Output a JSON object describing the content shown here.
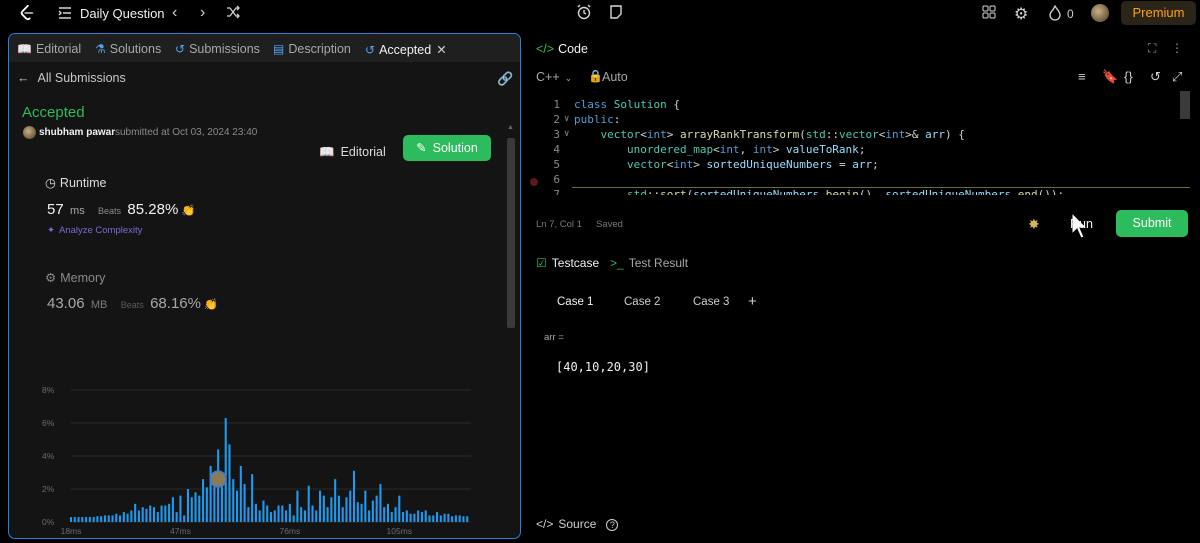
{
  "topbar": {
    "daily_question": "Daily Question",
    "flame_count": "0",
    "premium": "Premium"
  },
  "left": {
    "tabs": [
      {
        "label": "Editorial"
      },
      {
        "label": "Solutions"
      },
      {
        "label": "Submissions"
      },
      {
        "label": "Description"
      },
      {
        "label": "Accepted"
      }
    ],
    "back_label": "All Submissions",
    "status": "Accepted",
    "user": "shubham pawar",
    "submitted": "submitted at Oct 03, 2024 23:40",
    "editorial_btn": "Editorial",
    "solution_btn": "Solution",
    "runtime": {
      "title": "Runtime",
      "value": "57",
      "unit": "ms",
      "beats_label": "Beats",
      "beats": "85.28%",
      "analyze": "Analyze Complexity"
    },
    "memory": {
      "title": "Memory",
      "value": "43.06",
      "unit": "MB",
      "beats_label": "Beats",
      "beats": "68.16%"
    }
  },
  "chart_data": {
    "type": "bar",
    "yticks": [
      "8%",
      "6%",
      "4%",
      "2%",
      "0%"
    ],
    "ylim": [
      0,
      8
    ],
    "xticks": [
      {
        "label": "18ms",
        "x": 18
      },
      {
        "label": "47ms",
        "x": 47
      },
      {
        "label": "76ms",
        "x": 76
      },
      {
        "label": "105ms",
        "x": 105
      }
    ],
    "xlim": [
      18,
      124
    ],
    "x": [
      18,
      19,
      20,
      21,
      22,
      23,
      24,
      25,
      26,
      27,
      28,
      29,
      30,
      31,
      32,
      33,
      34,
      35,
      36,
      37,
      38,
      39,
      40,
      41,
      42,
      43,
      44,
      45,
      46,
      47,
      48,
      49,
      50,
      51,
      52,
      53,
      54,
      55,
      56,
      57,
      58,
      59,
      60,
      61,
      62,
      63,
      64,
      65,
      66,
      67,
      68,
      69,
      70,
      71,
      72,
      73,
      74,
      75,
      76,
      77,
      78,
      79,
      80,
      81,
      82,
      83,
      84,
      85,
      86,
      87,
      88,
      89,
      90,
      91,
      92,
      93,
      94,
      95,
      96,
      97,
      98,
      99,
      100,
      101,
      102,
      103,
      104,
      105,
      106,
      107,
      108,
      109,
      110,
      111,
      112,
      113,
      114,
      115,
      116,
      117,
      118,
      119,
      120,
      121,
      122,
      123
    ],
    "values": [
      0.3,
      0.3,
      0.3,
      0.3,
      0.3,
      0.3,
      0.3,
      0.35,
      0.35,
      0.4,
      0.4,
      0.4,
      0.5,
      0.4,
      0.6,
      0.5,
      0.7,
      1.1,
      0.7,
      0.9,
      0.8,
      1.0,
      0.9,
      0.6,
      1.0,
      1.0,
      1.1,
      1.5,
      0.6,
      1.6,
      0.4,
      2.0,
      1.5,
      1.8,
      1.6,
      2.6,
      2.1,
      3.4,
      2.5,
      4.4,
      2.3,
      6.3,
      4.7,
      2.6,
      1.9,
      3.4,
      2.3,
      0.9,
      2.9,
      1.1,
      0.7,
      1.3,
      1.0,
      0.6,
      0.7,
      1.0,
      1.0,
      0.7,
      1.1,
      0.4,
      1.9,
      0.9,
      0.7,
      2.2,
      1.0,
      0.7,
      1.9,
      1.6,
      0.9,
      1.5,
      2.6,
      1.6,
      0.9,
      1.5,
      1.9,
      3.1,
      1.2,
      1.1,
      1.9,
      0.7,
      1.3,
      1.6,
      2.3,
      0.9,
      1.1,
      0.6,
      0.9,
      1.6,
      0.6,
      0.7,
      0.5,
      0.5,
      0.7,
      0.6,
      0.7,
      0.4,
      0.4,
      0.6,
      0.4,
      0.5,
      0.5,
      0.35,
      0.4,
      0.4,
      0.35,
      0.35
    ]
  },
  "right": {
    "code_title": "Code",
    "language": "C++",
    "mode": "Auto",
    "code_lines": [
      {
        "n": "1"
      },
      {
        "n": "2"
      },
      {
        "n": "3"
      },
      {
        "n": "4"
      },
      {
        "n": "5"
      },
      {
        "n": "6"
      },
      {
        "n": "7"
      }
    ],
    "status_pos": "Ln 7, Col 1",
    "status_saved": "Saved",
    "run": "Run",
    "submit": "Submit",
    "testcase_tab": "Testcase",
    "testresult_tab": "Test Result",
    "cases": [
      "Case 1",
      "Case 2",
      "Case 3"
    ],
    "add_case": "+",
    "arr_label": "arr =",
    "arr_value": "[40,10,20,30]",
    "source": "Source"
  }
}
